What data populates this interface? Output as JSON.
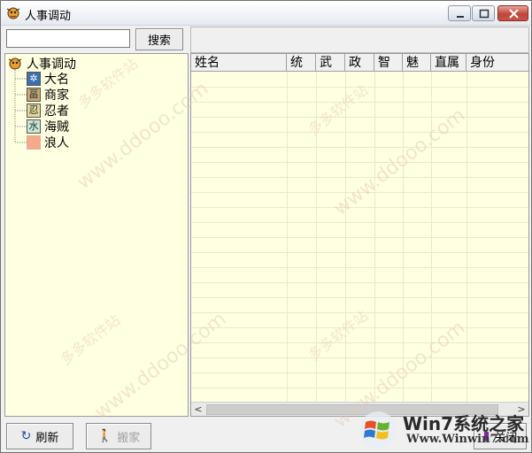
{
  "window": {
    "title": "人事调动",
    "buttons": [
      "minimize",
      "maximize",
      "close"
    ]
  },
  "search": {
    "value": "",
    "button_label": "搜索"
  },
  "tree": {
    "root": {
      "label": "人事调动",
      "icon": "app-icon"
    },
    "children": [
      {
        "label": "大名",
        "icon": "daimyo-icon",
        "color": "#3b6fb0"
      },
      {
        "label": "商家",
        "icon": "merchant-icon",
        "color": "#8a6a2a"
      },
      {
        "label": "忍者",
        "icon": "ninja-icon",
        "color": "#6a5a2a"
      },
      {
        "label": "海贼",
        "icon": "pirate-icon",
        "color": "#2a7a5a"
      },
      {
        "label": "浪人",
        "icon": "ronin-icon",
        "color": "#f2a98c"
      }
    ]
  },
  "grid": {
    "columns": [
      "姓名",
      "统",
      "武",
      "政",
      "智",
      "魅",
      "直属",
      "身份"
    ],
    "rows": []
  },
  "buttons": {
    "refresh": "刷新",
    "move": "搬家",
    "close": "关闭"
  },
  "watermark": {
    "site_cn": "多多软件站",
    "site_url": "www.ddooo.com"
  },
  "brand": {
    "name": "Win7系统之家",
    "url": "Www.Winwin7.com"
  },
  "colors": {
    "panel_bg": "#ffffe1",
    "window_bg": "#f0f0f0",
    "close_red": "#c0453a"
  }
}
